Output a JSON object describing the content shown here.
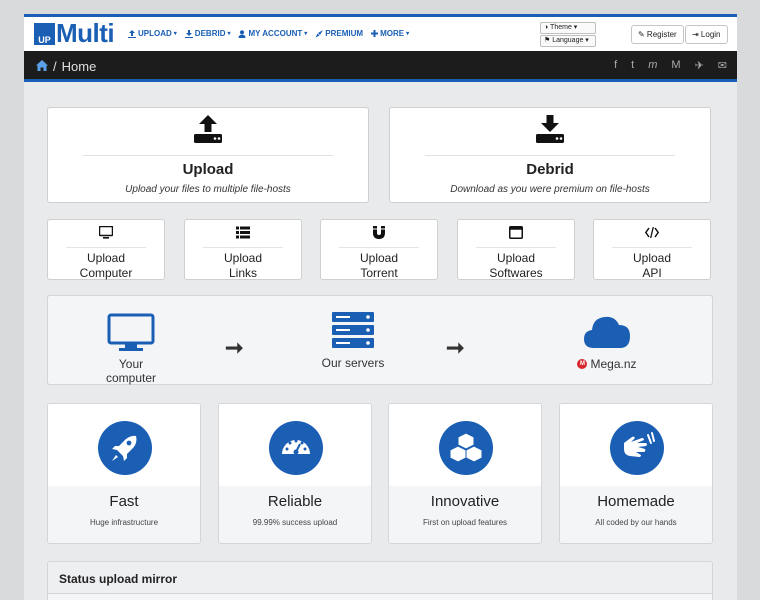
{
  "logo": {
    "badge": "UP",
    "name": "Multi"
  },
  "nav": [
    {
      "icon": "upload-icon",
      "label": "UPLOAD",
      "caret": "▾"
    },
    {
      "icon": "download-icon",
      "label": "DEBRID",
      "caret": "▾"
    },
    {
      "icon": "user-icon",
      "label": "MY ACCOUNT",
      "caret": "▾"
    },
    {
      "icon": "rocket-icon",
      "label": "PREMIUM",
      "caret": ""
    },
    {
      "icon": "plus-icon",
      "label": "MORE",
      "caret": "▾"
    }
  ],
  "selects": {
    "theme": "◑ Theme ▾",
    "language": "⚑ Language ▾"
  },
  "auth": {
    "register": "✎ Register",
    "login": "⇥ Login"
  },
  "breadcrumb": {
    "separator": "/",
    "current": "Home"
  },
  "social": [
    "f",
    "t",
    "m",
    "M",
    "✈",
    "✉"
  ],
  "big_cards": [
    {
      "title": "Upload",
      "subtitle": "Upload your files to multiple file-hosts",
      "icon": "upload-tray-icon"
    },
    {
      "title": "Debrid",
      "subtitle": "Download as you were premium on file-hosts",
      "icon": "download-tray-icon"
    }
  ],
  "small_cards": [
    {
      "line1": "Upload",
      "line2": "Computer",
      "icon": "monitor-icon"
    },
    {
      "line1": "Upload",
      "line2": "Links",
      "icon": "list-icon"
    },
    {
      "line1": "Upload",
      "line2": "Torrent",
      "icon": "magnet-icon"
    },
    {
      "line1": "Upload",
      "line2": "Softwares",
      "icon": "window-icon"
    },
    {
      "line1": "Upload",
      "line2": "API",
      "icon": "code-icon"
    }
  ],
  "flow": {
    "computer": "Your computer",
    "servers": "Our servers",
    "host": "Mega.nz",
    "arrow": "➞"
  },
  "features": [
    {
      "name": "Fast",
      "desc": "Huge infrastructure",
      "icon": "rocket-icon"
    },
    {
      "name": "Reliable",
      "desc": "99.99% success upload",
      "icon": "gauge-icon"
    },
    {
      "name": "Innovative",
      "desc": "First on upload features",
      "icon": "cubes-icon"
    },
    {
      "name": "Homemade",
      "desc": "All coded by our hands",
      "icon": "sign-language-icon"
    }
  ],
  "status": {
    "title": "Status upload mirror"
  },
  "colors": {
    "brand": "#1a5fb4",
    "dark_bar": "#1c1c1c",
    "mega": "#d9272e"
  }
}
